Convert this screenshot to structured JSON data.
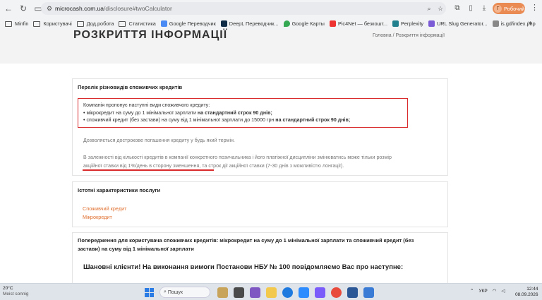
{
  "browser": {
    "url_host": "microcash.com.ua",
    "url_path": "/disclosure#twoCalculator",
    "profile_label": "Робочий",
    "profile_initial": "Г",
    "bookmarks": [
      "Minfin",
      "Користувачі",
      "Дод.робота",
      "Статистика",
      "Google Переводчик",
      "DeepL Переводчик...",
      "Google Карты",
      "Pic4Net — безкошт...",
      "Perplexity",
      "URL Slug Generator...",
      "is.gd/index.php"
    ]
  },
  "site": {
    "title": "РОЗКРИТТЯ ІНФОРМАЦІЇ",
    "breadcrumb_home": "Головна",
    "breadcrumb_sep": "/",
    "breadcrumb_current": "Розкриття інформації"
  },
  "panel1": {
    "heading": "Перелік різновидів споживчих кредитів",
    "intro": "Компанія пропонує наступні види споживчого кредиту:",
    "item1_normal": "мікрокредит на суму до 1 мінімальної зарплати ",
    "item1_bold": "на стандартний строк 90 днів;",
    "item2_normal": "споживчий кредит (без застави) на суму від 1 мінімальної зарплати до 15000 грн ",
    "item2_bold": "на стандартний строк 90 днів;",
    "early": "Дозволяється дострокове погашення кредиту у будь який термін.",
    "rate_line1": "В залежності від кількості кредитів в компанії конкретного позичальника і його платіжної дисципліни змінюватись може тільки розмір",
    "rate_line2": "акційної ставки від 1%/день в сторону зменшення, та строк дії акційної ставки (7-30 днів з можливістю лонгації)."
  },
  "panel2": {
    "heading": "Істотні характеристики послуги",
    "link1": "Споживчий кредит",
    "link2": "Мікрокредит"
  },
  "panel3": {
    "heading_line1": "Попередження для користувача споживчих кредитів: мікрокредит на суму до 1 мінімальної зарплати та споживчий кредит (без",
    "heading_line2": "застави) на суму від 1 мінімальної зарплати",
    "notice": "Шановні клієнти! На виконання вимоги Постанови НБУ № 100 повідомляємо Вас про наступне:"
  },
  "taskbar": {
    "temp": "20°C",
    "weather": "Meist sonnig",
    "search": "Пошук",
    "lang": "УКР",
    "time": "12:44",
    "date": "08.09.2026"
  },
  "colors": {
    "accent_link": "#e0702f",
    "highlight": "#d92b2b",
    "profile": "#e98b53"
  }
}
